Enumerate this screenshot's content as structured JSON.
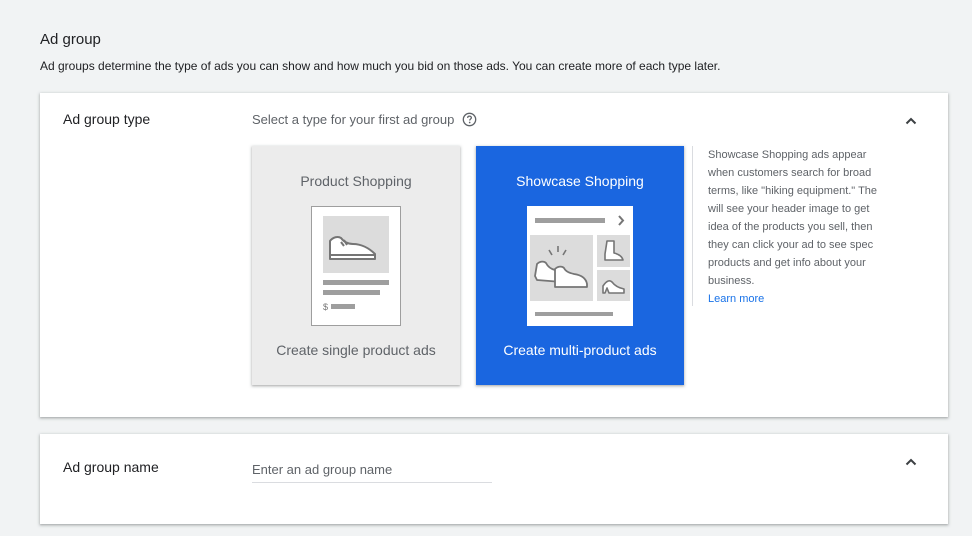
{
  "section": {
    "title": "Ad group",
    "description": "Ad groups determine the type of ads you can show and how much you bid on those ads. You can create more of each type later."
  },
  "type_card": {
    "label": "Ad group type",
    "prompt": "Select a type for your first ad group",
    "help_icon": "help-circle-icon",
    "collapse_icon": "chevron-up-icon",
    "options": [
      {
        "title": "Product Shopping",
        "subtitle": "Create single product ads",
        "selected": false
      },
      {
        "title": "Showcase Shopping",
        "subtitle": "Create multi-product ads",
        "selected": true
      }
    ],
    "selected_color": "#1a66e0",
    "description_lines": [
      "Showcase Shopping ads appear",
      "when customers search for broad",
      "terms, like \"hiking equipment.\" The",
      "will see your header image to get",
      "idea of the products you sell, then",
      "they can click your ad to see spec",
      "products and get info about your",
      "business."
    ],
    "learn_more": "Learn more"
  },
  "name_card": {
    "label": "Ad group name",
    "placeholder": "Enter an ad group name",
    "value": "",
    "collapse_icon": "chevron-up-icon"
  }
}
